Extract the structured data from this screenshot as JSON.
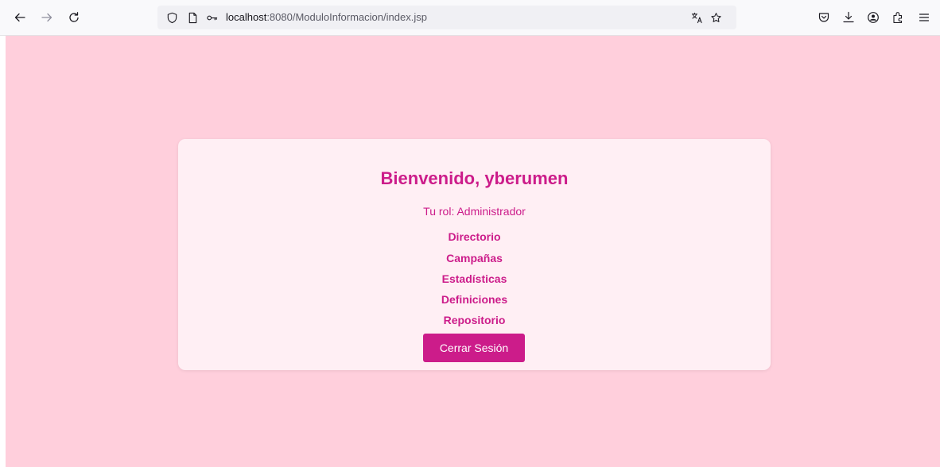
{
  "browser": {
    "url_host": "localhost",
    "url_path": ":8080/ModuloInformacion/index.jsp"
  },
  "card": {
    "welcome": "Bienvenido, yberumen",
    "role": "Tu rol: Administrador",
    "links": [
      {
        "label": "Directorio"
      },
      {
        "label": "Campañas"
      },
      {
        "label": "Estadísticas"
      },
      {
        "label": "Definiciones"
      },
      {
        "label": "Repositorio"
      }
    ],
    "logout_label": "Cerrar Sesión"
  },
  "colors": {
    "page_background": "#ffcfdc",
    "card_background": "#ffeff4",
    "accent": "#cc1c8a"
  },
  "icons": [
    "back-icon",
    "forward-icon",
    "reload-icon",
    "shield-icon",
    "page-icon",
    "key-icon",
    "translate-icon",
    "bookmark-star-icon",
    "pocket-icon",
    "download-icon",
    "account-icon",
    "extensions-icon",
    "menu-icon"
  ]
}
